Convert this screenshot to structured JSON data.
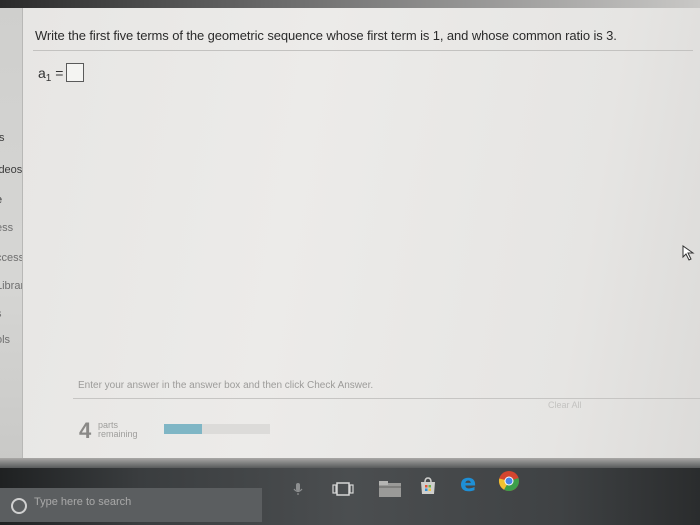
{
  "question": {
    "text": "Write the first five terms of the geometric sequence whose first term is 1, and whose common ratio is 3.",
    "answer_label_base": "a",
    "answer_label_sub": "1",
    "answer_label_eq": "=",
    "answer_value": ""
  },
  "sidebar": {
    "items": [
      {
        "label": "ts"
      },
      {
        "label": "ideos"
      },
      {
        "label": "e"
      },
      {
        "label": "ess"
      },
      {
        "label": "ccess"
      },
      {
        "label": "Library"
      },
      {
        "label": "s"
      },
      {
        "label": "ols"
      }
    ]
  },
  "footer": {
    "instruction": "Enter your answer in the answer box and then click Check Answer.",
    "faint_link": "Clear All",
    "parts_number": "4",
    "parts_label_1": "parts",
    "parts_label_2": "remaining",
    "progress_fraction": 0.36
  },
  "taskbar": {
    "search_placeholder": "Type here to search",
    "icons": [
      "microphone-icon",
      "task-view-icon",
      "file-explorer-icon",
      "store-icon",
      "edge-icon",
      "chrome-icon"
    ]
  },
  "colors": {
    "progress": "#7fb6c5",
    "edge": "#1e8fd6",
    "chrome_red": "#d4452f",
    "chrome_green": "#3c9f4a",
    "chrome_yellow": "#f1c232",
    "chrome_blue": "#4a86e8"
  }
}
